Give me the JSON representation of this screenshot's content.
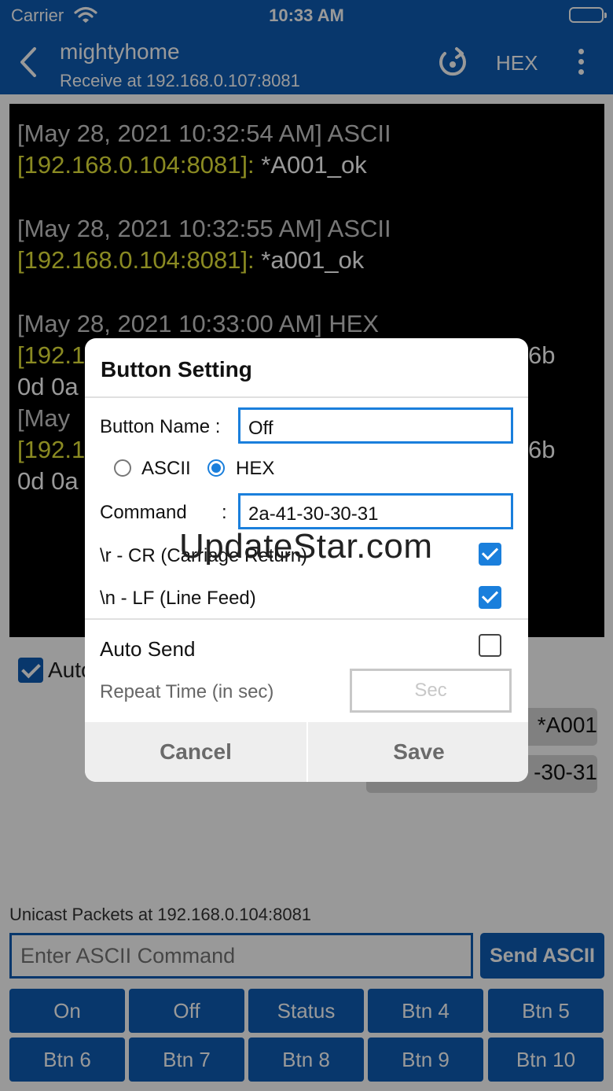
{
  "status_bar": {
    "carrier": "Carrier",
    "time": "10:33 AM",
    "wifi_icon": "wifi-icon",
    "battery_icon": "battery-icon"
  },
  "nav": {
    "title": "mightyhome",
    "subtitle": "Receive at 192.168.0.107:8081",
    "mode_label": "HEX",
    "icons": [
      "back-chevron-icon",
      "refresh-icon",
      "more-vertical-icon"
    ]
  },
  "log": [
    {
      "header": "[May 28, 2021 10:32:54 AM] ASCII",
      "source": "[192.168.0.104:8081]:",
      "message": " *A001_ok"
    },
    {
      "header": "[May 28, 2021 10:32:55 AM] ASCII",
      "source": "[192.168.0.104:8081]:",
      "message": " *a001_ok"
    },
    {
      "header": "[May 28, 2021 10:33:00 AM] HEX",
      "source": "[192.1",
      "message": "6b",
      "message_line2": "0d 0a"
    },
    {
      "header": "[May",
      "source": "[192.1",
      "message": "6b",
      "message_line2": "0d 0a"
    }
  ],
  "auto_scroll": {
    "label": "Auto",
    "checked": true
  },
  "saved_commands": [
    "*A001",
    "-30-31"
  ],
  "unicast": {
    "label": "Unicast Packets at 192.168.0.104:8081",
    "input_placeholder": "Enter ASCII Command",
    "send_label": "Send ASCII"
  },
  "buttons": [
    "On",
    "Off",
    "Status",
    "Btn 4",
    "Btn 5",
    "Btn 6",
    "Btn 7",
    "Btn 8",
    "Btn 9",
    "Btn 10"
  ],
  "dialog": {
    "title": "Button Setting",
    "name_label": "Button Name :",
    "name_value": "Off",
    "radio_ascii": "ASCII",
    "radio_hex": "HEX",
    "selected_mode": "HEX",
    "command_label": "Command",
    "command_colon": ":",
    "command_value": "2a-41-30-30-31",
    "cr_label": "\\r - CR (Carriage Return)",
    "cr_checked": true,
    "lf_label": "\\n - LF (Line Feed)",
    "lf_checked": true,
    "auto_send_label": "Auto Send",
    "auto_send_checked": false,
    "repeat_label": "Repeat Time (in sec)",
    "repeat_placeholder": "Sec",
    "cancel_label": "Cancel",
    "save_label": "Save"
  },
  "watermark": "UpdateStar.com",
  "colors": {
    "primary": "#0e5cb5",
    "dialog_accent": "#1a7fdc",
    "terminal_bg": "#000000",
    "log_address": "#e6e63a",
    "log_header": "#c8c8c8"
  }
}
